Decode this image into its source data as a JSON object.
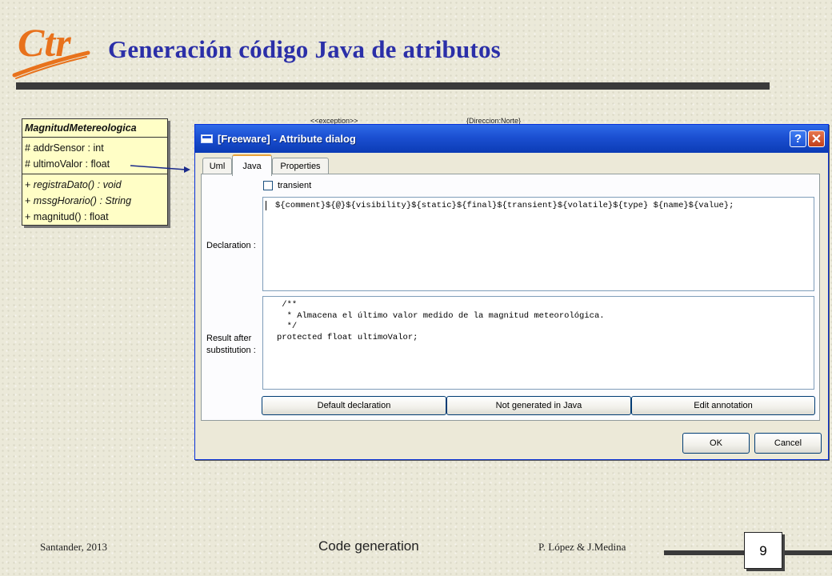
{
  "slide": {
    "logo_text": "Ctr",
    "title": "Generación código Java de atributos"
  },
  "uml_class": {
    "name": "MagnitudMetereologica",
    "attributes": [
      {
        "vis": "#",
        "text": "addrSensor : int"
      },
      {
        "vis": "#",
        "text": "ultimoValor : float"
      }
    ],
    "operations": [
      {
        "vis": "+",
        "text": "registraDato() : void",
        "italic": true
      },
      {
        "vis": "+",
        "text": "mssgHorario() : String",
        "italic": true
      },
      {
        "vis": "+",
        "text": "magnitud() : float",
        "italic": false
      }
    ]
  },
  "background_labels": [
    "<<exception>>",
    "{Direccion:Norte}"
  ],
  "dialog": {
    "title": "[Freeware] - Attribute dialog",
    "help_symbol": "?",
    "close_symbol": "✕",
    "tabs": [
      {
        "label": "Uml",
        "active": false
      },
      {
        "label": "Java",
        "active": true
      },
      {
        "label": "Properties",
        "active": false
      }
    ],
    "transient_checkbox": {
      "label": "transient",
      "checked": false
    },
    "declaration": {
      "label": "Declaration :",
      "value": "${comment}${@}${visibility}${static}${final}${transient}${volatile}${type} ${name}${value};"
    },
    "result": {
      "label_line1": "Result after",
      "label_line2": "substitution :",
      "lines": [
        " /**",
        "  * Almacena el último valor medido de la magnitud meteorológica.",
        "  */",
        "protected float ultimoValor;"
      ]
    },
    "buttons": {
      "default_declaration": "Default declaration",
      "not_generated": "Not generated in Java",
      "edit_annotation": "Edit annotation",
      "ok": "OK",
      "cancel": "Cancel"
    }
  },
  "footer": {
    "left": "Santander, 2013",
    "center": "Code generation",
    "right": "P. López & J.Medina",
    "page": "9"
  },
  "colors": {
    "title": "#2b2fa8",
    "logo": "#e8721c",
    "titlebar": "#0b3bb5",
    "uml_fill": "#fffec6"
  }
}
